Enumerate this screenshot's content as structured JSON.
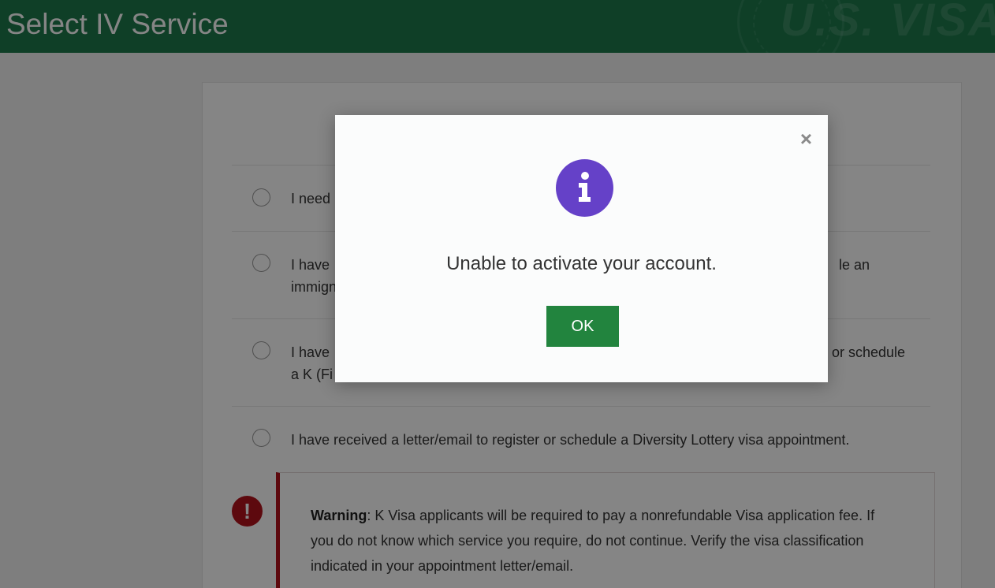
{
  "header": {
    "title": "Select IV Service",
    "watermark": "U.S. VISA"
  },
  "options": [
    {
      "label": "I need"
    },
    {
      "label": "I have",
      "label_end": "le an",
      "label_line2": "immign"
    },
    {
      "label": "I have",
      "label_end": "or schedule",
      "label_line2": "a K (Fi"
    },
    {
      "label": "I have received a letter/email to register or schedule a Diversity Lottery visa appointment."
    }
  ],
  "warning": {
    "title": "Warning",
    "text": ": K Visa applicants will be required to pay a nonrefundable Visa application fee. If you do not know which service you require, do not continue. Verify the visa classification indicated in your appointment letter/email."
  },
  "modal": {
    "message": "Unable to activate your account.",
    "ok_label": "OK",
    "close_glyph": "×",
    "icon": "info-icon",
    "icon_color": "#6541c8",
    "button_color": "#22843e"
  },
  "colors": {
    "header_green": "#1d7a4c",
    "warning_red": "#b3131b"
  }
}
